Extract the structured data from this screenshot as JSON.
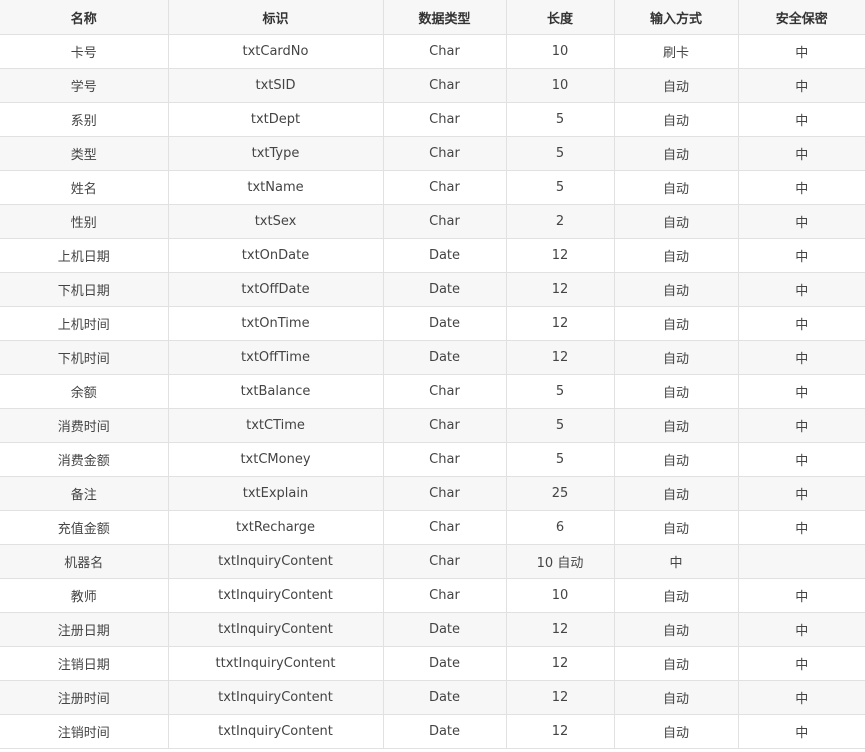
{
  "headers": [
    "名称",
    "标识",
    "数据类型",
    "长度",
    "输入方式",
    "安全保密"
  ],
  "rows": [
    [
      "卡号",
      "txtCardNo",
      "Char",
      "10",
      "刷卡",
      "中"
    ],
    [
      "学号",
      "txtSID",
      "Char",
      "10",
      "自动",
      "中"
    ],
    [
      "系别",
      "txtDept",
      "Char",
      "5",
      "自动",
      "中"
    ],
    [
      "类型",
      "txtType",
      "Char",
      "5",
      "自动",
      "中"
    ],
    [
      "姓名",
      "txtName",
      "Char",
      "5",
      "自动",
      "中"
    ],
    [
      "性别",
      "txtSex",
      "Char",
      "2",
      "自动",
      "中"
    ],
    [
      "上机日期",
      "txtOnDate",
      "Date",
      "12",
      "自动",
      "中"
    ],
    [
      "下机日期",
      "txtOffDate",
      "Date",
      "12",
      "自动",
      "中"
    ],
    [
      "上机时间",
      "txtOnTime",
      "Date",
      "12",
      "自动",
      "中"
    ],
    [
      "下机时间",
      "txtOffTime",
      "Date",
      "12",
      "自动",
      "中"
    ],
    [
      "余额",
      "txtBalance",
      "Char",
      "5",
      "自动",
      "中"
    ],
    [
      "消费时间",
      "txtCTime",
      "Char",
      "5",
      "自动",
      "中"
    ],
    [
      "消费金额",
      "txtCMoney",
      "Char",
      "5",
      "自动",
      "中"
    ],
    [
      "备注",
      "txtExplain",
      "Char",
      "25",
      "自动",
      "中"
    ],
    [
      "充值金额",
      "txtRecharge",
      "Char",
      "6",
      "自动",
      "中"
    ],
    [
      "机器名",
      "txtInquiryContent",
      "Char",
      "10 自动",
      "中",
      ""
    ],
    [
      "教师",
      "txtInquiryContent",
      "Char",
      "10",
      "自动",
      "中"
    ],
    [
      "注册日期",
      "txtInquiryContent",
      "Date",
      "12",
      "自动",
      "中"
    ],
    [
      "注销日期",
      "ttxtInquiryContent",
      "Date",
      "12",
      "自动",
      "中"
    ],
    [
      "注册时间",
      "txtInquiryContent",
      "Date",
      "12",
      "自动",
      "中"
    ],
    [
      "注销时间",
      "txtInquiryContent",
      "Date",
      "12",
      "自动",
      "中"
    ]
  ]
}
